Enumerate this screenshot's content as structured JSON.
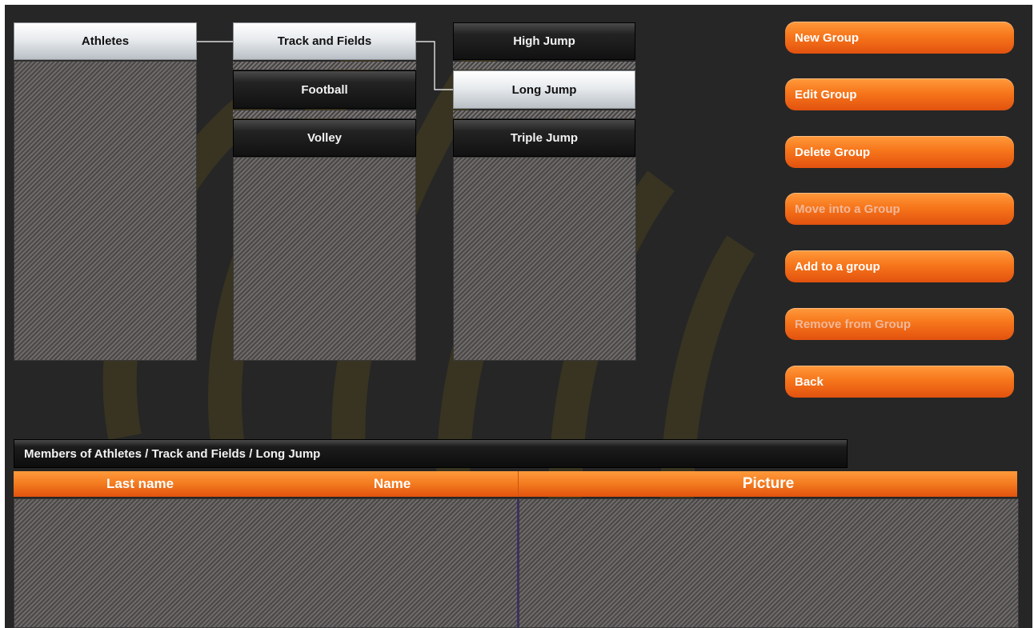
{
  "groups": {
    "level1": [
      {
        "label": "Athletes",
        "selected": true
      }
    ],
    "level2": [
      {
        "label": "Track and Fields",
        "selected": true
      },
      {
        "label": "Football",
        "selected": false
      },
      {
        "label": "Volley",
        "selected": false
      }
    ],
    "level3": [
      {
        "label": "High Jump",
        "selected": false
      },
      {
        "label": "Long Jump",
        "selected": true
      },
      {
        "label": "Triple Jump",
        "selected": false
      }
    ]
  },
  "actions": {
    "new_group": "New Group",
    "edit_group": "Edit Group",
    "delete_group": "Delete Group",
    "move_into_group": "Move into a Group",
    "add_to_group": "Add to a group",
    "remove_from_group": "Remove from Group",
    "back": "Back"
  },
  "members": {
    "title": "Members of Athletes / Track and Fields / Long Jump",
    "columns": {
      "last_name": "Last name",
      "name": "Name",
      "picture": "Picture"
    },
    "rows": []
  },
  "colors": {
    "accent_orange": "#f7761b",
    "background": "#262626",
    "selected_node": "#e8ebee",
    "unselected_node": "#1a1a1a"
  }
}
